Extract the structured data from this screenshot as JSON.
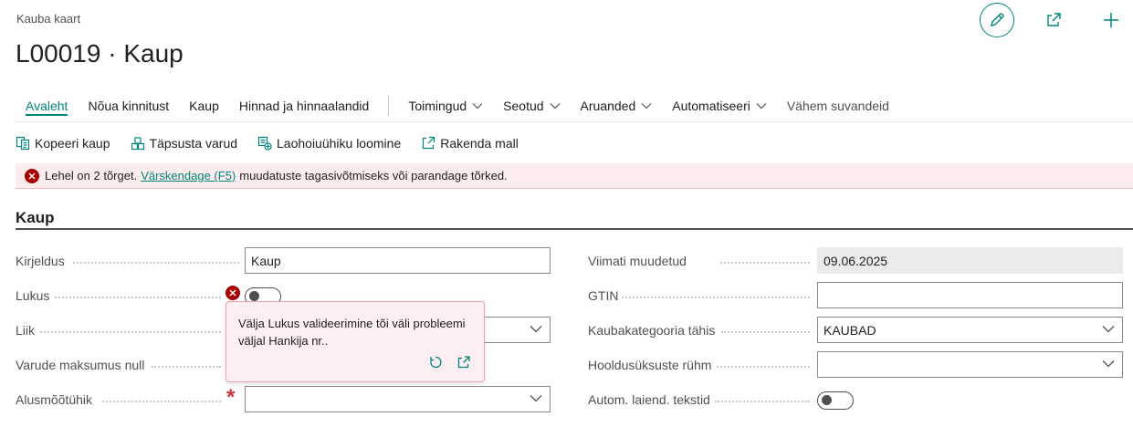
{
  "header": {
    "breadcrumb": "Kauba kaart",
    "title": "L00019 · Kaup",
    "buttons": [
      {
        "icon": "pencil-icon"
      },
      {
        "icon": "share-icon"
      },
      {
        "icon": "plus-icon"
      }
    ]
  },
  "tabs": [
    {
      "label": "Avaleht",
      "active": true
    },
    {
      "label": "Nõua kinnitust"
    },
    {
      "label": "Kaup"
    },
    {
      "label": "Hinnad ja hinnaalandid"
    },
    {
      "label": "Toimingud",
      "dropdown": true
    },
    {
      "label": "Seotud",
      "dropdown": true
    },
    {
      "label": "Aruanded",
      "dropdown": true
    },
    {
      "label": "Automatiseeri",
      "dropdown": true
    },
    {
      "label": "Vähem suvandeid"
    }
  ],
  "actions": [
    {
      "label": "Kopeeri kaup",
      "icon": "copy-icon"
    },
    {
      "label": "Täpsusta varud",
      "icon": "inventory-icon"
    },
    {
      "label": "Laohoiuühiku loomine",
      "icon": "create-sku-icon"
    },
    {
      "label": "Rakenda mall",
      "icon": "apply-template-icon"
    }
  ],
  "error_bar": {
    "before": "Lehel on 2 tõrget.",
    "link": "Värskendage (F5)",
    "after": "muudatuste tagasivõtmiseks või parandage tõrked."
  },
  "section": {
    "title": "Kaup",
    "left_fields": [
      {
        "label": "Kirjeldus",
        "type": "text",
        "value": "Kaup"
      },
      {
        "label": "Lukus",
        "type": "toggle",
        "checked": false,
        "error": true
      },
      {
        "label": "Liik",
        "type": "select",
        "value": ""
      },
      {
        "label": "Varude maksumus null",
        "type": "toggle",
        "checked": false
      },
      {
        "label": "Alusmõõtühik",
        "type": "select",
        "value": "",
        "required": true
      }
    ],
    "right_fields": [
      {
        "label": "Viimati muudetud",
        "type": "readonly",
        "value": "09.06.2025"
      },
      {
        "label": "GTIN",
        "type": "text",
        "value": ""
      },
      {
        "label": "Kaubakategooria tähis",
        "type": "select",
        "value": "KAUBAD"
      },
      {
        "label": "Hooldusüksuste rühm",
        "type": "select",
        "value": ""
      },
      {
        "label": "Autom. laiend. tekstid",
        "type": "toggle",
        "checked": false
      }
    ]
  },
  "tooltip": {
    "text": "Välja Lukus valideerimine tõi väli probleemi väljal Hankija nr..",
    "buttons": [
      {
        "icon": "undo-icon"
      },
      {
        "icon": "share-icon"
      }
    ]
  },
  "colors": {
    "accent": "#00857c",
    "error": "#a80000",
    "error_bg": "#fdecee",
    "required": "#d13438"
  }
}
